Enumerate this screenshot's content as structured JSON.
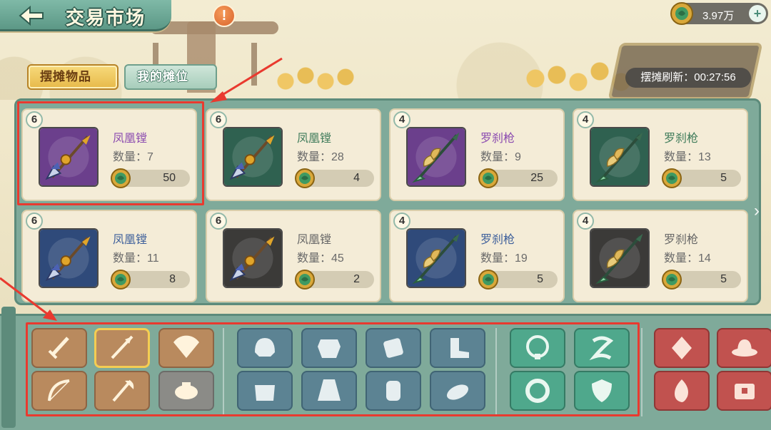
{
  "header": {
    "title": "交易市场",
    "alert_icon": "!",
    "currency_amount": "3.97万",
    "plus_label": "+"
  },
  "tabs": [
    {
      "label": "摆摊物品",
      "active": true
    },
    {
      "label": "我的摊位",
      "active": false
    }
  ],
  "refresh": {
    "text": "摆摊刷新：00:27:56"
  },
  "items": [
    {
      "level": "6",
      "name": "凤凰镗",
      "qty": "数量：7",
      "price": "50",
      "rarity": "purple",
      "weapon": "halberd"
    },
    {
      "level": "6",
      "name": "凤凰镗",
      "qty": "数量：28",
      "price": "4",
      "rarity": "green",
      "weapon": "halberd"
    },
    {
      "level": "4",
      "name": "罗刹枪",
      "qty": "数量：9",
      "price": "25",
      "rarity": "purple",
      "weapon": "spear"
    },
    {
      "level": "4",
      "name": "罗刹枪",
      "qty": "数量：13",
      "price": "5",
      "rarity": "green",
      "weapon": "spear"
    },
    {
      "level": "6",
      "name": "凤凰镗",
      "qty": "数量：11",
      "price": "8",
      "rarity": "blue",
      "weapon": "halberd"
    },
    {
      "level": "6",
      "name": "凤凰镗",
      "qty": "数量：45",
      "price": "2",
      "rarity": "gray",
      "weapon": "halberd"
    },
    {
      "level": "4",
      "name": "罗刹枪",
      "qty": "数量：19",
      "price": "5",
      "rarity": "blue",
      "weapon": "spear"
    },
    {
      "level": "4",
      "name": "罗刹枪",
      "qty": "数量：14",
      "price": "5",
      "rarity": "gray",
      "weapon": "spear"
    }
  ],
  "categories": [
    {
      "icon": "sword-icon",
      "group": "weapon",
      "selected": false
    },
    {
      "icon": "spear-icon",
      "group": "weapon",
      "selected": true
    },
    {
      "icon": "fan-icon",
      "group": "weapon",
      "selected": false
    },
    {
      "icon": "bow-icon",
      "group": "weapon",
      "selected": false
    },
    {
      "icon": "axe-icon",
      "group": "weapon",
      "selected": false
    },
    {
      "icon": "pouch-icon",
      "group": "locked",
      "selected": false
    },
    {
      "icon": "helmet-icon",
      "group": "armor",
      "selected": false
    },
    {
      "icon": "chest-armor-icon",
      "group": "armor",
      "selected": false
    },
    {
      "icon": "bracer-icon",
      "group": "armor",
      "selected": false
    },
    {
      "icon": "boots-icon",
      "group": "armor",
      "selected": false
    },
    {
      "icon": "shoulder-icon",
      "group": "armor",
      "selected": false
    },
    {
      "icon": "robe-icon",
      "group": "armor",
      "selected": false
    },
    {
      "icon": "glove-icon",
      "group": "armor",
      "selected": false
    },
    {
      "icon": "shoe-icon",
      "group": "armor",
      "selected": false
    },
    {
      "icon": "necklace-icon",
      "group": "accessory",
      "selected": false
    },
    {
      "icon": "sash-icon",
      "group": "accessory",
      "selected": false
    },
    {
      "icon": "ring-icon",
      "group": "accessory",
      "selected": false
    },
    {
      "icon": "shield-icon",
      "group": "accessory",
      "selected": false
    },
    {
      "icon": "gem-icon",
      "group": "material",
      "selected": false
    },
    {
      "icon": "hat-icon",
      "group": "material",
      "selected": false
    },
    {
      "icon": "flame-icon",
      "group": "material",
      "selected": false
    },
    {
      "icon": "box-icon",
      "group": "material",
      "selected": false
    }
  ],
  "colors": {
    "purple_bg": "#6b3f8c",
    "green_bg": "#2f6150",
    "blue_bg": "#2f4a7a",
    "gray_bg": "#3b3a38",
    "highlight": "#e93a2f"
  }
}
